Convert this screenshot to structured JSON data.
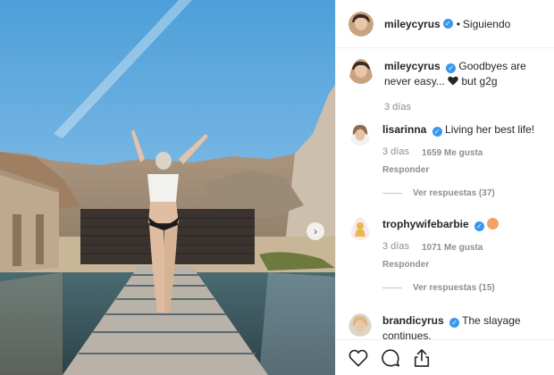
{
  "post": {
    "author": "mileycyrus",
    "follow_status": "Siguiendo",
    "caption": "Goodbyes are never easy... ❤ but g2g",
    "caption_pre": "Goodbyes are never easy...",
    "caption_post": "but g2g",
    "time": "3 días"
  },
  "comments": [
    {
      "user": "lisarinna",
      "text": "Living her best life!",
      "time": "3 días",
      "likes": "1659 Me gusta",
      "reply": "Responder",
      "view_replies": "Ver respuestas (37)"
    },
    {
      "user": "trophywifebarbie",
      "text": "",
      "emoji": "peach-emoji",
      "time": "3 días",
      "likes": "1071 Me gusta",
      "reply": "Responder",
      "view_replies": "Ver respuestas (15)"
    },
    {
      "user": "brandicyrus",
      "text": "The slayage continues."
    }
  ],
  "actions": {
    "like_icon": "heart-icon",
    "comment_icon": "comment-icon",
    "share_icon": "share-icon"
  },
  "colors": {
    "verified": "#3897f0",
    "meta_text": "#8e8e8e",
    "border": "#efefef"
  }
}
